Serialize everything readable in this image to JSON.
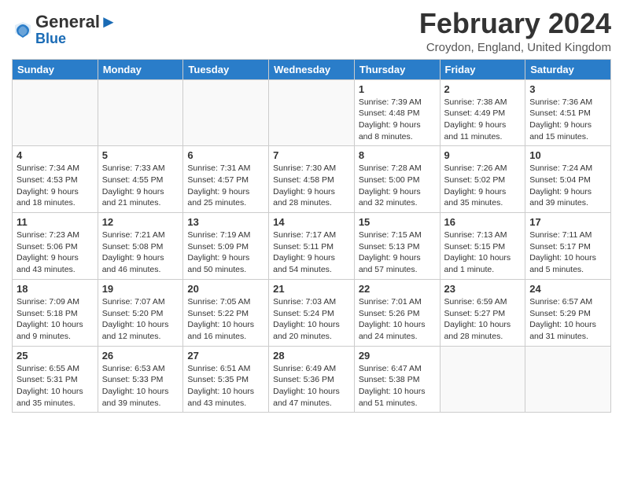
{
  "header": {
    "logo_line1": "General",
    "logo_line2": "Blue",
    "month": "February 2024",
    "location": "Croydon, England, United Kingdom"
  },
  "days_of_week": [
    "Sunday",
    "Monday",
    "Tuesday",
    "Wednesday",
    "Thursday",
    "Friday",
    "Saturday"
  ],
  "weeks": [
    [
      {
        "day": "",
        "info": ""
      },
      {
        "day": "",
        "info": ""
      },
      {
        "day": "",
        "info": ""
      },
      {
        "day": "",
        "info": ""
      },
      {
        "day": "1",
        "info": "Sunrise: 7:39 AM\nSunset: 4:48 PM\nDaylight: 9 hours\nand 8 minutes."
      },
      {
        "day": "2",
        "info": "Sunrise: 7:38 AM\nSunset: 4:49 PM\nDaylight: 9 hours\nand 11 minutes."
      },
      {
        "day": "3",
        "info": "Sunrise: 7:36 AM\nSunset: 4:51 PM\nDaylight: 9 hours\nand 15 minutes."
      }
    ],
    [
      {
        "day": "4",
        "info": "Sunrise: 7:34 AM\nSunset: 4:53 PM\nDaylight: 9 hours\nand 18 minutes."
      },
      {
        "day": "5",
        "info": "Sunrise: 7:33 AM\nSunset: 4:55 PM\nDaylight: 9 hours\nand 21 minutes."
      },
      {
        "day": "6",
        "info": "Sunrise: 7:31 AM\nSunset: 4:57 PM\nDaylight: 9 hours\nand 25 minutes."
      },
      {
        "day": "7",
        "info": "Sunrise: 7:30 AM\nSunset: 4:58 PM\nDaylight: 9 hours\nand 28 minutes."
      },
      {
        "day": "8",
        "info": "Sunrise: 7:28 AM\nSunset: 5:00 PM\nDaylight: 9 hours\nand 32 minutes."
      },
      {
        "day": "9",
        "info": "Sunrise: 7:26 AM\nSunset: 5:02 PM\nDaylight: 9 hours\nand 35 minutes."
      },
      {
        "day": "10",
        "info": "Sunrise: 7:24 AM\nSunset: 5:04 PM\nDaylight: 9 hours\nand 39 minutes."
      }
    ],
    [
      {
        "day": "11",
        "info": "Sunrise: 7:23 AM\nSunset: 5:06 PM\nDaylight: 9 hours\nand 43 minutes."
      },
      {
        "day": "12",
        "info": "Sunrise: 7:21 AM\nSunset: 5:08 PM\nDaylight: 9 hours\nand 46 minutes."
      },
      {
        "day": "13",
        "info": "Sunrise: 7:19 AM\nSunset: 5:09 PM\nDaylight: 9 hours\nand 50 minutes."
      },
      {
        "day": "14",
        "info": "Sunrise: 7:17 AM\nSunset: 5:11 PM\nDaylight: 9 hours\nand 54 minutes."
      },
      {
        "day": "15",
        "info": "Sunrise: 7:15 AM\nSunset: 5:13 PM\nDaylight: 9 hours\nand 57 minutes."
      },
      {
        "day": "16",
        "info": "Sunrise: 7:13 AM\nSunset: 5:15 PM\nDaylight: 10 hours\nand 1 minute."
      },
      {
        "day": "17",
        "info": "Sunrise: 7:11 AM\nSunset: 5:17 PM\nDaylight: 10 hours\nand 5 minutes."
      }
    ],
    [
      {
        "day": "18",
        "info": "Sunrise: 7:09 AM\nSunset: 5:18 PM\nDaylight: 10 hours\nand 9 minutes."
      },
      {
        "day": "19",
        "info": "Sunrise: 7:07 AM\nSunset: 5:20 PM\nDaylight: 10 hours\nand 12 minutes."
      },
      {
        "day": "20",
        "info": "Sunrise: 7:05 AM\nSunset: 5:22 PM\nDaylight: 10 hours\nand 16 minutes."
      },
      {
        "day": "21",
        "info": "Sunrise: 7:03 AM\nSunset: 5:24 PM\nDaylight: 10 hours\nand 20 minutes."
      },
      {
        "day": "22",
        "info": "Sunrise: 7:01 AM\nSunset: 5:26 PM\nDaylight: 10 hours\nand 24 minutes."
      },
      {
        "day": "23",
        "info": "Sunrise: 6:59 AM\nSunset: 5:27 PM\nDaylight: 10 hours\nand 28 minutes."
      },
      {
        "day": "24",
        "info": "Sunrise: 6:57 AM\nSunset: 5:29 PM\nDaylight: 10 hours\nand 31 minutes."
      }
    ],
    [
      {
        "day": "25",
        "info": "Sunrise: 6:55 AM\nSunset: 5:31 PM\nDaylight: 10 hours\nand 35 minutes."
      },
      {
        "day": "26",
        "info": "Sunrise: 6:53 AM\nSunset: 5:33 PM\nDaylight: 10 hours\nand 39 minutes."
      },
      {
        "day": "27",
        "info": "Sunrise: 6:51 AM\nSunset: 5:35 PM\nDaylight: 10 hours\nand 43 minutes."
      },
      {
        "day": "28",
        "info": "Sunrise: 6:49 AM\nSunset: 5:36 PM\nDaylight: 10 hours\nand 47 minutes."
      },
      {
        "day": "29",
        "info": "Sunrise: 6:47 AM\nSunset: 5:38 PM\nDaylight: 10 hours\nand 51 minutes."
      },
      {
        "day": "",
        "info": ""
      },
      {
        "day": "",
        "info": ""
      }
    ]
  ]
}
